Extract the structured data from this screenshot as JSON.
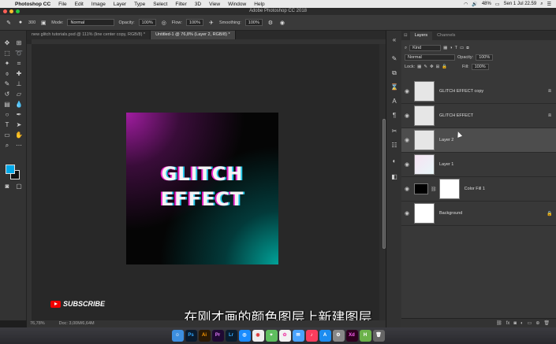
{
  "menubar": {
    "apple": "",
    "items": [
      "Photoshop CC",
      "File",
      "Edit",
      "Image",
      "Layer",
      "Type",
      "Select",
      "Filter",
      "3D",
      "View",
      "Window",
      "Help"
    ],
    "battery": "48%",
    "clock": "Sen 1 Jul  22.59"
  },
  "titlebar": {
    "title": "Adobe Photoshop CC 2018"
  },
  "options": {
    "mode_label": "Mode:",
    "mode_value": "Normal",
    "opacity_label": "Opacity:",
    "opacity_value": "100%",
    "flow_label": "Flow:",
    "flow_value": "100%",
    "smoothing_label": "Smoothing:",
    "smoothing_value": "100%",
    "brush_size": "300"
  },
  "tabs": [
    {
      "label": "new glitch tutorials.psd @ 111% (line center copy, RGB/8) *",
      "active": false
    },
    {
      "label": "Untitled-1 @ 76,8% (Layer 2, RGB/8) *",
      "active": true
    }
  ],
  "canvas": {
    "line1": "GLITCH",
    "line2": "EFFECT",
    "gradient_colors": {
      "top_left": "#aa1eaa",
      "bottom_right": "#00aaa0",
      "base": "#050505"
    }
  },
  "status": {
    "zoom": "76,78%",
    "doc": "Doc: 3,00M/6,64M"
  },
  "subscribe": {
    "label": "SUBSCRIBE"
  },
  "subtitle": {
    "text": "在刚才画的颜色图层上新建图层"
  },
  "panel": {
    "tabs": [
      "Layers",
      "Channels"
    ],
    "kind_label": "Kind",
    "blend_mode": "Normal",
    "opacity_label": "Opacity:",
    "opacity_value": "100%",
    "lock_label": "Lock:",
    "fill_label": "Fill:",
    "fill_value": "100%",
    "layers": [
      {
        "name": "GLITCH EFFECT copy",
        "selected": false
      },
      {
        "name": "GLITCH EFFECT",
        "selected": false
      },
      {
        "name": "Layer 2",
        "selected": true
      },
      {
        "name": "Layer 1",
        "selected": false
      },
      {
        "name": "Color Fill 1",
        "selected": false
      },
      {
        "name": "Background",
        "selected": false
      }
    ]
  },
  "colors": {
    "foreground": "#00a8e8",
    "background": "#111111"
  },
  "dock": [
    "Finder",
    "Ps",
    "Ai",
    "Pr",
    "Lr",
    "Safari",
    "Chrome",
    "Maps",
    "Photos",
    "Mail",
    "Music",
    "App Store",
    "Settings",
    "Xd",
    "Notes",
    "Trash"
  ]
}
